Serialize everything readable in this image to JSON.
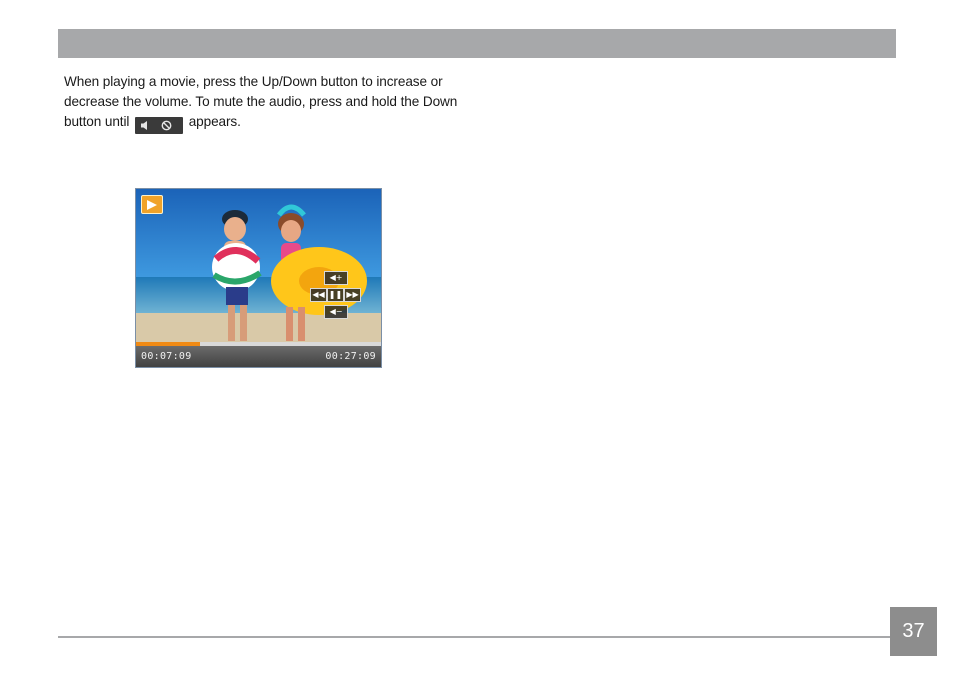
{
  "paragraph": {
    "text_before": "When playing a movie, press the Up/Down button to increase or decrease the volume. To mute the audio, press and hold the Down button until",
    "text_after": "appears."
  },
  "icons": {
    "mute_indicator": "speaker-muted-icon",
    "play_badge": "play-icon",
    "volume_up": "volume-up-icon",
    "volume_down": "volume-down-icon",
    "rewind": "rewind-icon",
    "pause": "pause-icon",
    "fast_forward": "fast-forward-icon"
  },
  "player": {
    "elapsed": "00:07:09",
    "total": "00:27:09",
    "progress_fraction": 0.26,
    "controls": {
      "vol_up": "◀+",
      "rewind": "◀◀",
      "pause": "❚❚",
      "forward": "▶▶",
      "vol_down": "◀−"
    }
  },
  "colors": {
    "header_bar": "#a7a8aa",
    "progress": "#f08a14",
    "play_badge": "#f0a32a"
  },
  "page": {
    "number": "37"
  }
}
